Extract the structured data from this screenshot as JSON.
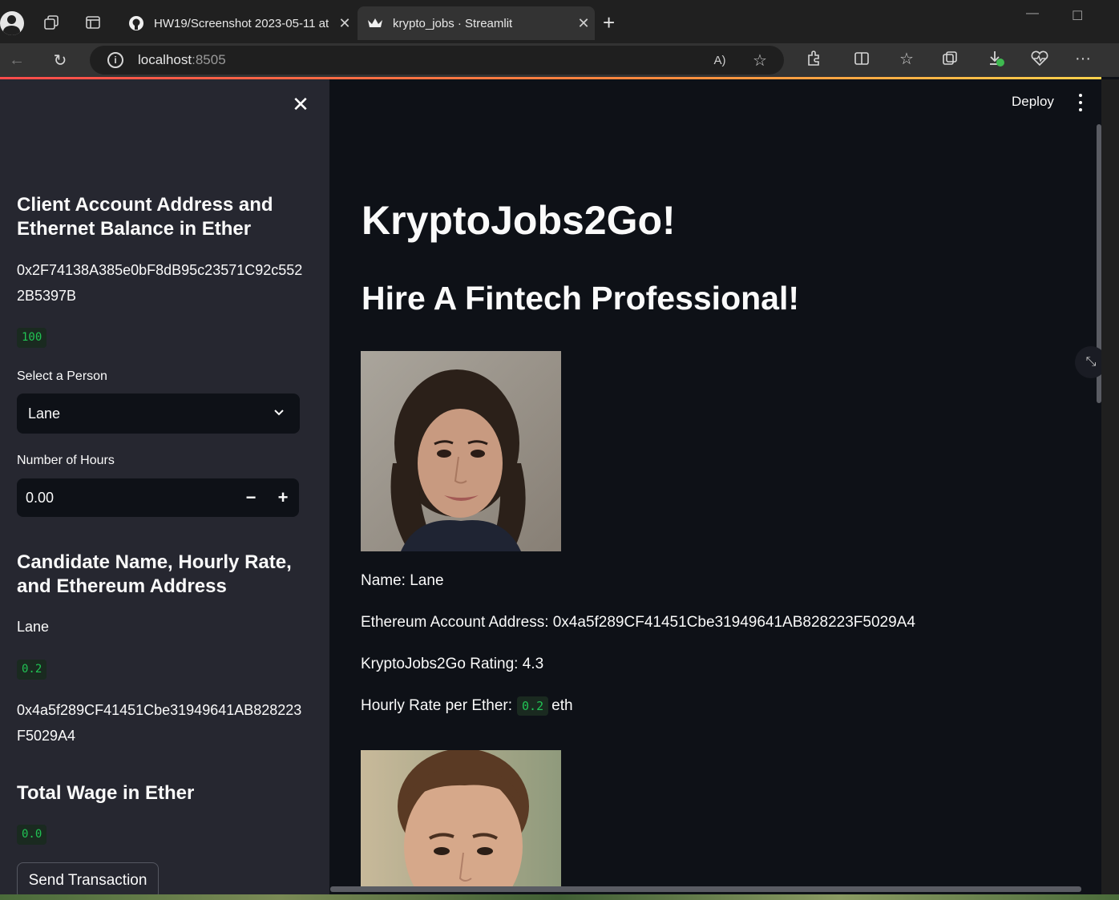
{
  "browser": {
    "tabs": [
      {
        "title": "HW19/Screenshot 2023-05-11 at",
        "active": false,
        "icon": "github-icon"
      },
      {
        "title": "krypto_jobs · Streamlit",
        "active": true,
        "icon": "streamlit-crown-icon"
      }
    ],
    "url_host": "localhost",
    "url_port": ":8505"
  },
  "colors": {
    "background": "#0e1117",
    "sidebar": "#262730",
    "code_text": "#21c354",
    "accent": "#ff4b4b"
  },
  "sidebar": {
    "account_heading_line1": "Client Account Address and",
    "account_heading_line2": "Ethernet Balance in Ether",
    "account_address_line1": "0x2F74138A385e0bF8dB95c23571C92c552",
    "account_address_line2": "2B5397B",
    "balance": "100",
    "select_label": "Select a Person",
    "select_value": "Lane",
    "hours_label": "Number of Hours",
    "hours_value": "0.00",
    "candidate_heading_line1": "Candidate Name, Hourly Rate,",
    "candidate_heading_line2": "and Ethereum Address",
    "candidate_name": "Lane",
    "candidate_rate": "0.2",
    "candidate_address_line1": "0x4a5f289CF41451Cbe31949641AB828223",
    "candidate_address_line2": "F5029A4",
    "wage_heading": "Total Wage in Ether",
    "wage_value": "0.0",
    "send_button": "Send Transaction"
  },
  "header": {
    "deploy": "Deploy"
  },
  "main": {
    "title": "KryptoJobs2Go!",
    "subtitle": "Hire A Fintech Professional!",
    "candidate": {
      "name_line": "Name: Lane",
      "address_line": "Ethereum Account Address: 0x4a5f289CF41451Cbe31949641AB828223F5029A4",
      "rating_line": "KryptoJobs2Go Rating: 4.3",
      "rate_prefix": "Hourly Rate per Ether:",
      "rate_value": "0.2",
      "rate_suffix": "eth"
    }
  }
}
